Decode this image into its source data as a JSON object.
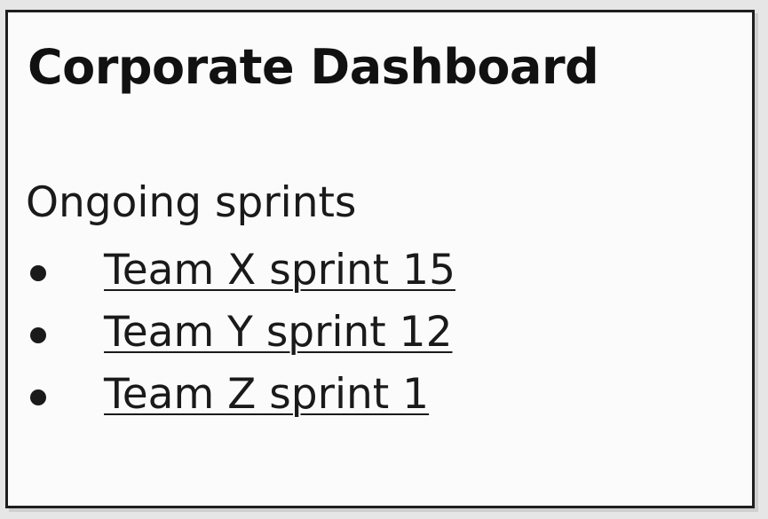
{
  "dashboard": {
    "title": "Corporate Dashboard",
    "section_label": "Ongoing sprints",
    "sprints": [
      {
        "label": "Team X sprint 15"
      },
      {
        "label": "Team Y sprint 12"
      },
      {
        "label": "Team Z sprint 1"
      }
    ]
  }
}
